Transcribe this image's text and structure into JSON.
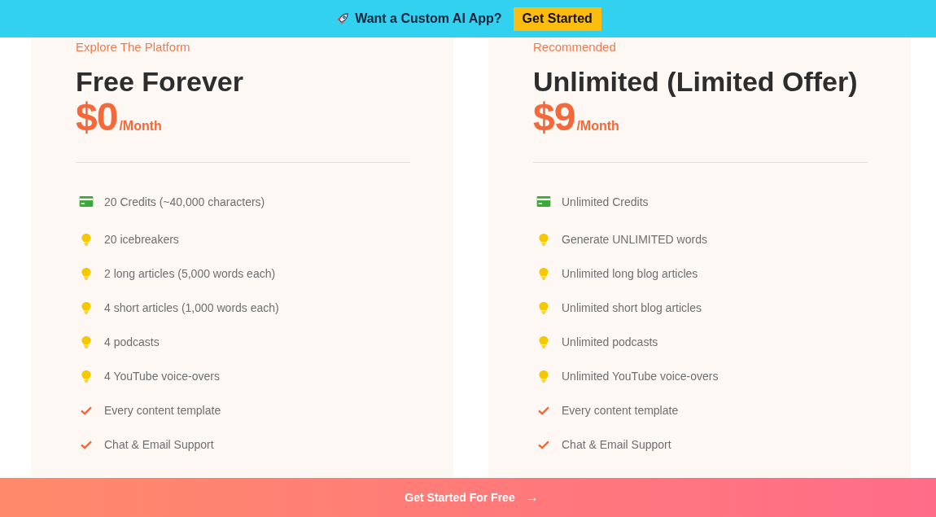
{
  "banner": {
    "text": "Want a Custom AI App?",
    "button": "Get Started"
  },
  "plans": [
    {
      "eyebrow": "Explore The Platform",
      "name": "Free Forever",
      "price": "$0",
      "period": "/Month",
      "features": [
        {
          "kind": "credit",
          "text": "20 Credits (~40,000 characters)"
        },
        {
          "kind": "bulb",
          "text": "20 icebreakers"
        },
        {
          "kind": "bulb",
          "text": "2 long articles (5,000 words each)"
        },
        {
          "kind": "bulb",
          "text": "4 short articles (1,000 words each)"
        },
        {
          "kind": "bulb",
          "text": "4 podcasts"
        },
        {
          "kind": "bulb",
          "text": "4 YouTube voice-overs"
        },
        {
          "kind": "check",
          "text": "Every content template"
        },
        {
          "kind": "check",
          "text": "Chat & Email Support"
        }
      ]
    },
    {
      "eyebrow": "Recommended",
      "name": "Unlimited (Limited Offer)",
      "price": "$9",
      "period": "/Month",
      "features": [
        {
          "kind": "credit",
          "text": "Unlimited Credits"
        },
        {
          "kind": "bulb",
          "text": "Generate UNLIMITED words"
        },
        {
          "kind": "bulb",
          "text": "Unlimited long blog articles"
        },
        {
          "kind": "bulb",
          "text": "Unlimited short blog articles"
        },
        {
          "kind": "bulb",
          "text": "Unlimited podcasts"
        },
        {
          "kind": "bulb",
          "text": "Unlimited YouTube voice-overs"
        },
        {
          "kind": "check",
          "text": "Every content template"
        },
        {
          "kind": "check",
          "text": "Chat & Email Support"
        }
      ]
    }
  ],
  "cta": {
    "label": "Get Started For Free",
    "arrow": "→"
  }
}
